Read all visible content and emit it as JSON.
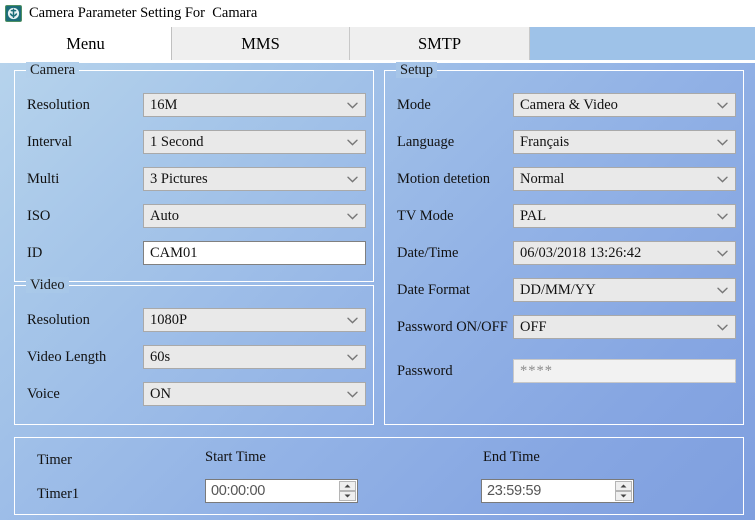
{
  "window": {
    "title": "Camera Parameter Setting For  Camara",
    "icon": "app-badge-icon"
  },
  "tabs": [
    {
      "label": "Menu",
      "active": true
    },
    {
      "label": "MMS",
      "active": false
    },
    {
      "label": "SMTP",
      "active": false
    }
  ],
  "groups": {
    "camera": {
      "legend": "Camera",
      "fields": [
        {
          "label": "Resolution",
          "value": "16M",
          "type": "combo"
        },
        {
          "label": "Interval",
          "value": "1 Second",
          "type": "combo"
        },
        {
          "label": "Multi",
          "value": "3 Pictures",
          "type": "combo"
        },
        {
          "label": "ISO",
          "value": "Auto",
          "type": "combo"
        },
        {
          "label": "ID",
          "value": "CAM01",
          "type": "textbox"
        }
      ]
    },
    "video": {
      "legend": "Video",
      "fields": [
        {
          "label": "Resolution",
          "value": "1080P",
          "type": "combo"
        },
        {
          "label": "Video Length",
          "value": "60s",
          "type": "combo"
        },
        {
          "label": "Voice",
          "value": "ON",
          "type": "combo"
        }
      ]
    },
    "setup": {
      "legend": "Setup",
      "fields": [
        {
          "label": "Mode",
          "value": "Camera & Video",
          "type": "combo"
        },
        {
          "label": "Language",
          "value": "Français",
          "type": "combo"
        },
        {
          "label": "Motion detetion",
          "value": "Normal",
          "type": "combo"
        },
        {
          "label": "TV Mode",
          "value": "PAL",
          "type": "combo"
        },
        {
          "label": "Date/Time",
          "value": "06/03/2018 13:26:42",
          "type": "combo"
        },
        {
          "label": "Date Format",
          "value": "DD/MM/YY",
          "type": "combo"
        },
        {
          "label": "Password ON/OFF",
          "value": "OFF",
          "type": "combo"
        },
        {
          "label": "Password",
          "value": "****",
          "type": "textbox-disabled"
        }
      ]
    },
    "timer": {
      "title": "Timer",
      "start_header": "Start Time",
      "end_header": "End Time",
      "rows": [
        {
          "label": "Timer1",
          "start": "00:00:00",
          "end": "23:59:59"
        }
      ]
    }
  },
  "colors": {
    "background_top": "#b6d3ec",
    "background_bottom": "#7f9fdf",
    "tabstrip": "#9ec2e8",
    "active_tab": "#ffffff",
    "inactive_tab": "#efefef",
    "combo_face": "#e9e9e9",
    "border": "#a9a9a9"
  }
}
